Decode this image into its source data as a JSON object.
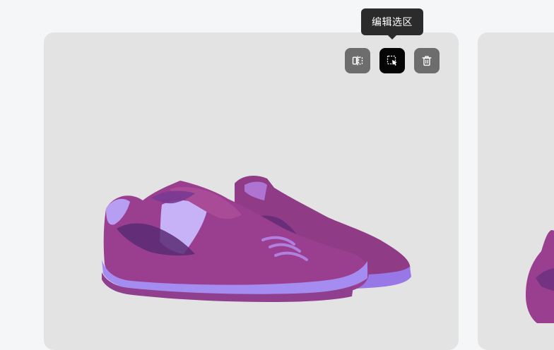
{
  "toolbar": {
    "tooltip_label": "编辑选区",
    "buttons": [
      {
        "name": "compare",
        "icon": "split-compare-icon",
        "state": "default"
      },
      {
        "name": "edit-selection",
        "icon": "edit-selection-icon",
        "state": "active"
      },
      {
        "name": "delete",
        "icon": "trash-icon",
        "state": "default"
      }
    ]
  },
  "images": {
    "main_card": {
      "subject": "purple-sneakers"
    },
    "next_card": {
      "subject": "purple-sneaker-partial"
    }
  },
  "colors": {
    "page_bg": "#f5f6f8",
    "card_bg": "#e3e3e3",
    "button_dark": "#6d6d6d",
    "button_active": "#050505",
    "tooltip_bg": "#2b2b2b",
    "shoe_primary": "#9a3f8f",
    "shoe_accent": "#a68cf0"
  }
}
